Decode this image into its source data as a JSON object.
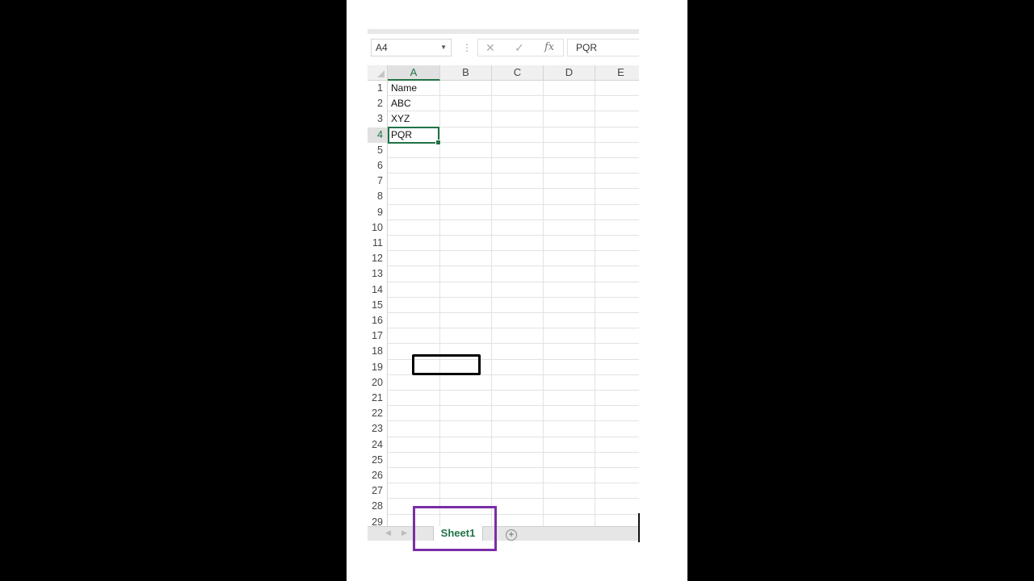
{
  "formula_bar": {
    "name_box": "A4",
    "cancel_icon": "close-icon",
    "enter_icon": "check-icon",
    "fx_label": "fx",
    "content": "PQR"
  },
  "columns": [
    "A",
    "B",
    "C",
    "D",
    "E"
  ],
  "rows": [
    "1",
    "2",
    "3",
    "4",
    "5",
    "6",
    "7",
    "8",
    "9",
    "10",
    "11",
    "12",
    "13",
    "14",
    "15",
    "16",
    "17",
    "18",
    "19",
    "20",
    "21",
    "22",
    "23",
    "24",
    "25",
    "26",
    "27",
    "28",
    "29"
  ],
  "cells": {
    "A1": "Name",
    "A2": "ABC",
    "A3": "XYZ",
    "A4": "PQR"
  },
  "selected_cell": "A4",
  "sheets": {
    "tabs": [
      "Sheet1"
    ],
    "add_icon": "plus-circle-icon"
  },
  "colors": {
    "accent": "#217346",
    "annotation_highlight": "#7a2ea6"
  }
}
